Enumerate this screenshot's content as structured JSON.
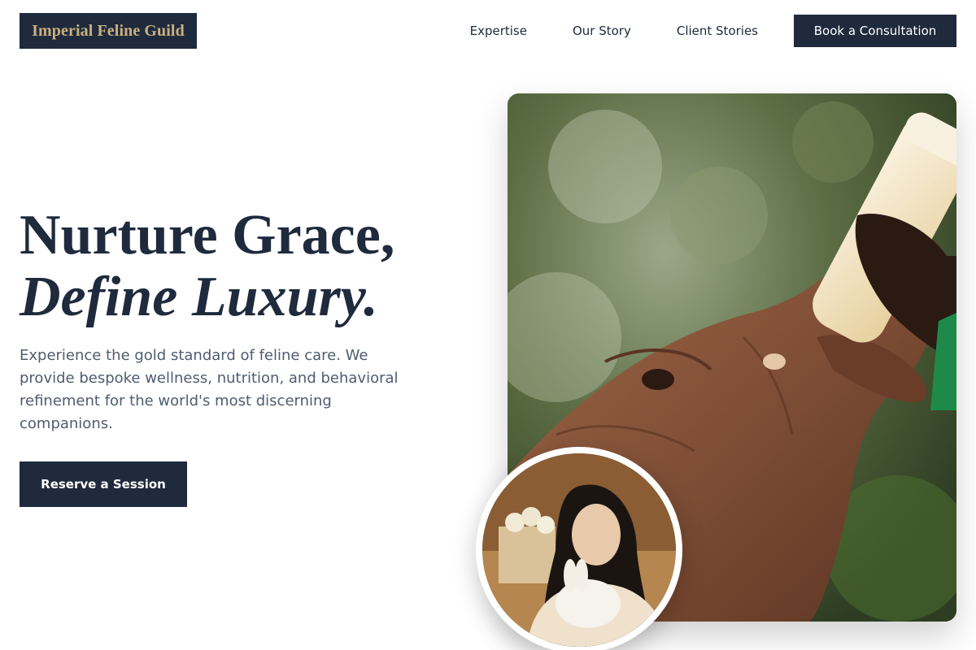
{
  "brand": {
    "name": "Imperial Feline Guild",
    "accent": "#cbb07f",
    "navy": "#1f2a3d"
  },
  "nav": {
    "links": [
      "Expertise",
      "Our Story",
      "Client Stories"
    ],
    "cta_label": "Book a Consultation"
  },
  "hero": {
    "headline_line1": "Nurture Grace,",
    "headline_line2": "Define Luxury.",
    "description": "Experience the gold standard of feline care. We provide bespoke wellness, nutrition, and behavioral refinement for the world's most discerning companions.",
    "button_label": "Reserve a Session"
  },
  "images": {
    "main": "photo of baby elephant drinking from a milk bottle held by a caretaker",
    "portrait": "photo of a woman holding a white rabbit"
  }
}
